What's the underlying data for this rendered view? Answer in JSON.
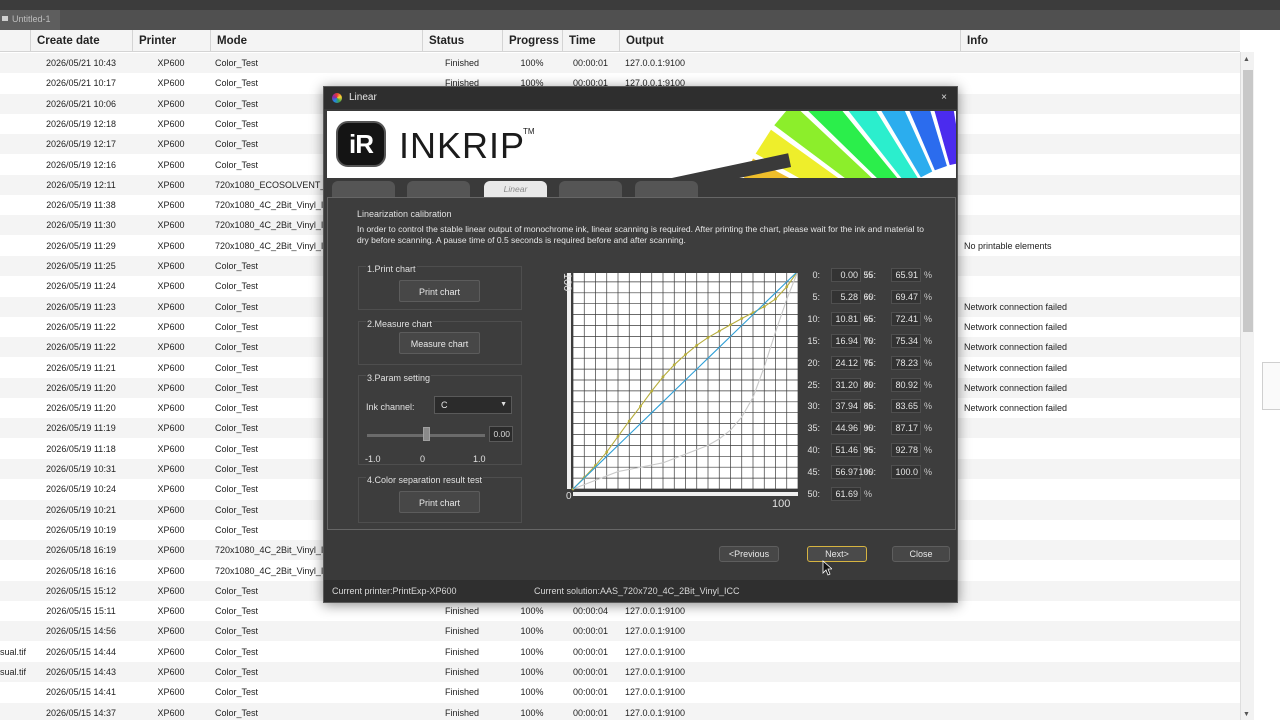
{
  "app": {
    "document_tab": "Untitled-1"
  },
  "job_table": {
    "columns": [
      "Create date",
      "Printer",
      "Mode",
      "Status",
      "Progress",
      "Time",
      "Output",
      "Info"
    ],
    "rows": [
      {
        "lead": "",
        "date": "2026/05/21 10:43",
        "printer": "XP600",
        "mode": "Color_Test",
        "status": "Finished",
        "progress": "100%",
        "time": "00:00:01",
        "output": "127.0.0.1:9100",
        "info": ""
      },
      {
        "lead": "",
        "date": "2026/05/21 10:17",
        "printer": "XP600",
        "mode": "Color_Test",
        "status": "Finished",
        "progress": "100%",
        "time": "00:00:01",
        "output": "127.0.0.1:9100",
        "info": ""
      },
      {
        "lead": "",
        "date": "2026/05/21 10:06",
        "printer": "XP600",
        "mode": "Color_Test",
        "status": "",
        "progress": "",
        "time": "",
        "output": "",
        "info": ""
      },
      {
        "lead": "",
        "date": "2026/05/19 12:18",
        "printer": "XP600",
        "mode": "Color_Test",
        "status": "",
        "progress": "",
        "time": "",
        "output": "",
        "info": ""
      },
      {
        "lead": "",
        "date": "2026/05/19 12:17",
        "printer": "XP600",
        "mode": "Color_Test",
        "status": "",
        "progress": "",
        "time": "",
        "output": "",
        "info": ""
      },
      {
        "lead": "",
        "date": "2026/05/19 12:16",
        "printer": "XP600",
        "mode": "Color_Test",
        "status": "",
        "progress": "",
        "time": "",
        "output": "",
        "info": ""
      },
      {
        "lead": "",
        "date": "2026/05/19 12:11",
        "printer": "XP600",
        "mode": "720x1080_ECOSOLVENT_2",
        "status": "",
        "progress": "",
        "time": "",
        "output": "",
        "info": ""
      },
      {
        "lead": "",
        "date": "2026/05/19 11:38",
        "printer": "XP600",
        "mode": "720x1080_4C_2Bit_Vinyl_IC",
        "status": "",
        "progress": "",
        "time": "",
        "output": "",
        "info": ""
      },
      {
        "lead": "",
        "date": "2026/05/19 11:30",
        "printer": "XP600",
        "mode": "720x1080_4C_2Bit_Vinyl_IC",
        "status": "",
        "progress": "",
        "time": "",
        "output": "",
        "info": ""
      },
      {
        "lead": "",
        "date": "2026/05/19 11:29",
        "printer": "XP600",
        "mode": "720x1080_4C_2Bit_Vinyl_IC",
        "status": "",
        "progress": "",
        "time": "",
        "output": "",
        "info": "No printable elements"
      },
      {
        "lead": "",
        "date": "2026/05/19 11:25",
        "printer": "XP600",
        "mode": "Color_Test",
        "status": "",
        "progress": "",
        "time": "",
        "output": "",
        "info": ""
      },
      {
        "lead": "",
        "date": "2026/05/19 11:24",
        "printer": "XP600",
        "mode": "Color_Test",
        "status": "",
        "progress": "",
        "time": "",
        "output": "",
        "info": ""
      },
      {
        "lead": "",
        "date": "2026/05/19 11:23",
        "printer": "XP600",
        "mode": "Color_Test",
        "status": "",
        "progress": "",
        "time": "",
        "output": "",
        "info": "Network connection failed"
      },
      {
        "lead": "",
        "date": "2026/05/19 11:22",
        "printer": "XP600",
        "mode": "Color_Test",
        "status": "",
        "progress": "",
        "time": "",
        "output": "",
        "info": "Network connection failed"
      },
      {
        "lead": "",
        "date": "2026/05/19 11:22",
        "printer": "XP600",
        "mode": "Color_Test",
        "status": "",
        "progress": "",
        "time": "",
        "output": "",
        "info": "Network connection failed"
      },
      {
        "lead": "",
        "date": "2026/05/19 11:21",
        "printer": "XP600",
        "mode": "Color_Test",
        "status": "",
        "progress": "",
        "time": "",
        "output": "",
        "info": "Network connection failed"
      },
      {
        "lead": "",
        "date": "2026/05/19 11:20",
        "printer": "XP600",
        "mode": "Color_Test",
        "status": "",
        "progress": "",
        "time": "",
        "output": "",
        "info": "Network connection failed"
      },
      {
        "lead": "",
        "date": "2026/05/19 11:20",
        "printer": "XP600",
        "mode": "Color_Test",
        "status": "",
        "progress": "",
        "time": "",
        "output": "",
        "info": "Network connection failed"
      },
      {
        "lead": "",
        "date": "2026/05/19 11:19",
        "printer": "XP600",
        "mode": "Color_Test",
        "status": "",
        "progress": "",
        "time": "",
        "output": "",
        "info": ""
      },
      {
        "lead": "",
        "date": "2026/05/19 11:18",
        "printer": "XP600",
        "mode": "Color_Test",
        "status": "",
        "progress": "",
        "time": "",
        "output": "",
        "info": ""
      },
      {
        "lead": "",
        "date": "2026/05/19 10:31",
        "printer": "XP600",
        "mode": "Color_Test",
        "status": "",
        "progress": "",
        "time": "",
        "output": "",
        "info": ""
      },
      {
        "lead": "",
        "date": "2026/05/19 10:24",
        "printer": "XP600",
        "mode": "Color_Test",
        "status": "",
        "progress": "",
        "time": "",
        "output": "",
        "info": ""
      },
      {
        "lead": "",
        "date": "2026/05/19 10:21",
        "printer": "XP600",
        "mode": "Color_Test",
        "status": "",
        "progress": "",
        "time": "",
        "output": "",
        "info": ""
      },
      {
        "lead": "",
        "date": "2026/05/19 10:19",
        "printer": "XP600",
        "mode": "Color_Test",
        "status": "",
        "progress": "",
        "time": "",
        "output": "",
        "info": ""
      },
      {
        "lead": "",
        "date": "2026/05/18 16:19",
        "printer": "XP600",
        "mode": "720x1080_4C_2Bit_Vinyl_IC",
        "status": "",
        "progress": "",
        "time": "",
        "output": "",
        "info": ""
      },
      {
        "lead": "",
        "date": "2026/05/18 16:16",
        "printer": "XP600",
        "mode": "720x1080_4C_2Bit_Vinyl_IC",
        "status": "",
        "progress": "",
        "time": "",
        "output": "",
        "info": ""
      },
      {
        "lead": "",
        "date": "2026/05/15 15:12",
        "printer": "XP600",
        "mode": "Color_Test",
        "status": "",
        "progress": "",
        "time": "",
        "output": "",
        "info": ""
      },
      {
        "lead": "",
        "date": "2026/05/15 15:11",
        "printer": "XP600",
        "mode": "Color_Test",
        "status": "Finished",
        "progress": "100%",
        "time": "00:00:04",
        "output": "127.0.0.1:9100",
        "info": ""
      },
      {
        "lead": "",
        "date": "2026/05/15 14:56",
        "printer": "XP600",
        "mode": "Color_Test",
        "status": "Finished",
        "progress": "100%",
        "time": "00:00:01",
        "output": "127.0.0.1:9100",
        "info": ""
      },
      {
        "lead": "sual.tif",
        "date": "2026/05/15 14:44",
        "printer": "XP600",
        "mode": "Color_Test",
        "status": "Finished",
        "progress": "100%",
        "time": "00:00:01",
        "output": "127.0.0.1:9100",
        "info": ""
      },
      {
        "lead": "sual.tif",
        "date": "2026/05/15 14:43",
        "printer": "XP600",
        "mode": "Color_Test",
        "status": "Finished",
        "progress": "100%",
        "time": "00:00:01",
        "output": "127.0.0.1:9100",
        "info": ""
      },
      {
        "lead": "",
        "date": "2026/05/15 14:41",
        "printer": "XP600",
        "mode": "Color_Test",
        "status": "Finished",
        "progress": "100%",
        "time": "00:00:01",
        "output": "127.0.0.1:9100",
        "info": ""
      },
      {
        "lead": "",
        "date": "2026/05/15 14:37",
        "printer": "XP600",
        "mode": "Color_Test",
        "status": "Finished",
        "progress": "100%",
        "time": "00:00:01",
        "output": "127.0.0.1:9100",
        "info": ""
      }
    ]
  },
  "dialog": {
    "title": "Linear",
    "brand": {
      "badge": "iR",
      "name": "INKRIP",
      "tm": "TM"
    },
    "tabs": [
      "",
      "",
      "Linear",
      "",
      ""
    ],
    "active_tab": 2,
    "calibration_title": "Linearization calibration",
    "description": "In order to control the stable linear output of monochrome ink, linear scanning is required. After printing the chart, please wait for the ink and material to dry before scanning. A pause time of 0.5 seconds is required before and after scanning.",
    "step1": {
      "title": "1.Print chart",
      "button": "Print chart"
    },
    "step2": {
      "title": "2.Measure chart",
      "button": "Measure chart"
    },
    "step3": {
      "title": "3.Param setting",
      "ink_label": "Ink channel:",
      "ink_value": "C",
      "slider_value": "0.00",
      "slider_level": 0.0,
      "ticks": [
        "-1.0",
        "0",
        "1.0"
      ]
    },
    "step4": {
      "title": "4.Color separation result test",
      "button": "Print chart"
    },
    "values": [
      {
        "label": "0:",
        "value": "0.00",
        "unit": "%"
      },
      {
        "label": "5:",
        "value": "5.28",
        "unit": "%"
      },
      {
        "label": "10:",
        "value": "10.81",
        "unit": "%"
      },
      {
        "label": "15:",
        "value": "16.94",
        "unit": "%"
      },
      {
        "label": "20:",
        "value": "24.12",
        "unit": "%"
      },
      {
        "label": "25:",
        "value": "31.20",
        "unit": "%"
      },
      {
        "label": "30:",
        "value": "37.94",
        "unit": "%"
      },
      {
        "label": "35:",
        "value": "44.96",
        "unit": "%"
      },
      {
        "label": "40:",
        "value": "51.46",
        "unit": "%"
      },
      {
        "label": "45:",
        "value": "56.97",
        "unit": "%"
      },
      {
        "label": "50:",
        "value": "61.69",
        "unit": "%"
      },
      {
        "label": "55:",
        "value": "65.91",
        "unit": "%"
      },
      {
        "label": "60:",
        "value": "69.47",
        "unit": "%"
      },
      {
        "label": "65:",
        "value": "72.41",
        "unit": "%"
      },
      {
        "label": "70:",
        "value": "75.34",
        "unit": "%"
      },
      {
        "label": "75:",
        "value": "78.23",
        "unit": "%"
      },
      {
        "label": "80:",
        "value": "80.92",
        "unit": "%"
      },
      {
        "label": "85:",
        "value": "83.65",
        "unit": "%"
      },
      {
        "label": "90:",
        "value": "87.17",
        "unit": "%"
      },
      {
        "label": "95:",
        "value": "92.78",
        "unit": "%"
      },
      {
        "label": "100:",
        "value": "100.0",
        "unit": "%"
      }
    ],
    "buttons": {
      "previous": "<Previous",
      "next": "Next>",
      "close": "Close"
    },
    "status": {
      "printer": "Current printer:PrintExp-XP600",
      "solution": "Current solution:AAS_720x720_4C_2Bit_Vinyl_ICC"
    },
    "close_icon": "×"
  },
  "chart_data": {
    "type": "line",
    "x": [
      0,
      5,
      10,
      15,
      20,
      25,
      30,
      35,
      40,
      45,
      50,
      55,
      60,
      65,
      70,
      75,
      80,
      85,
      90,
      95,
      100
    ],
    "series": [
      {
        "values": [
          0,
          5.28,
          10.81,
          16.94,
          24.12,
          31.2,
          37.94,
          44.96,
          51.46,
          56.97,
          61.69,
          65.91,
          69.47,
          72.41,
          75.34,
          78.23,
          80.92,
          83.65,
          87.17,
          92.78,
          100
        ]
      },
      {
        "values": [
          0,
          2,
          4,
          6,
          8,
          9,
          10,
          11,
          12,
          14,
          16,
          18,
          20,
          23,
          27,
          33,
          42,
          56,
          72,
          87,
          100
        ]
      },
      {
        "values": [
          0,
          5,
          10,
          15,
          20,
          25,
          30,
          35,
          40,
          45,
          50,
          55,
          60,
          65,
          70,
          75,
          80,
          85,
          90,
          95,
          100
        ]
      }
    ],
    "colors": [
      "#b7ad3c",
      "#c8c8c8",
      "#2f9fd6"
    ],
    "xlabel": "100",
    "ylabel": "100",
    "origin_label": "0",
    "xlim": [
      0,
      100
    ],
    "ylim": [
      0,
      100
    ],
    "grid": true
  }
}
